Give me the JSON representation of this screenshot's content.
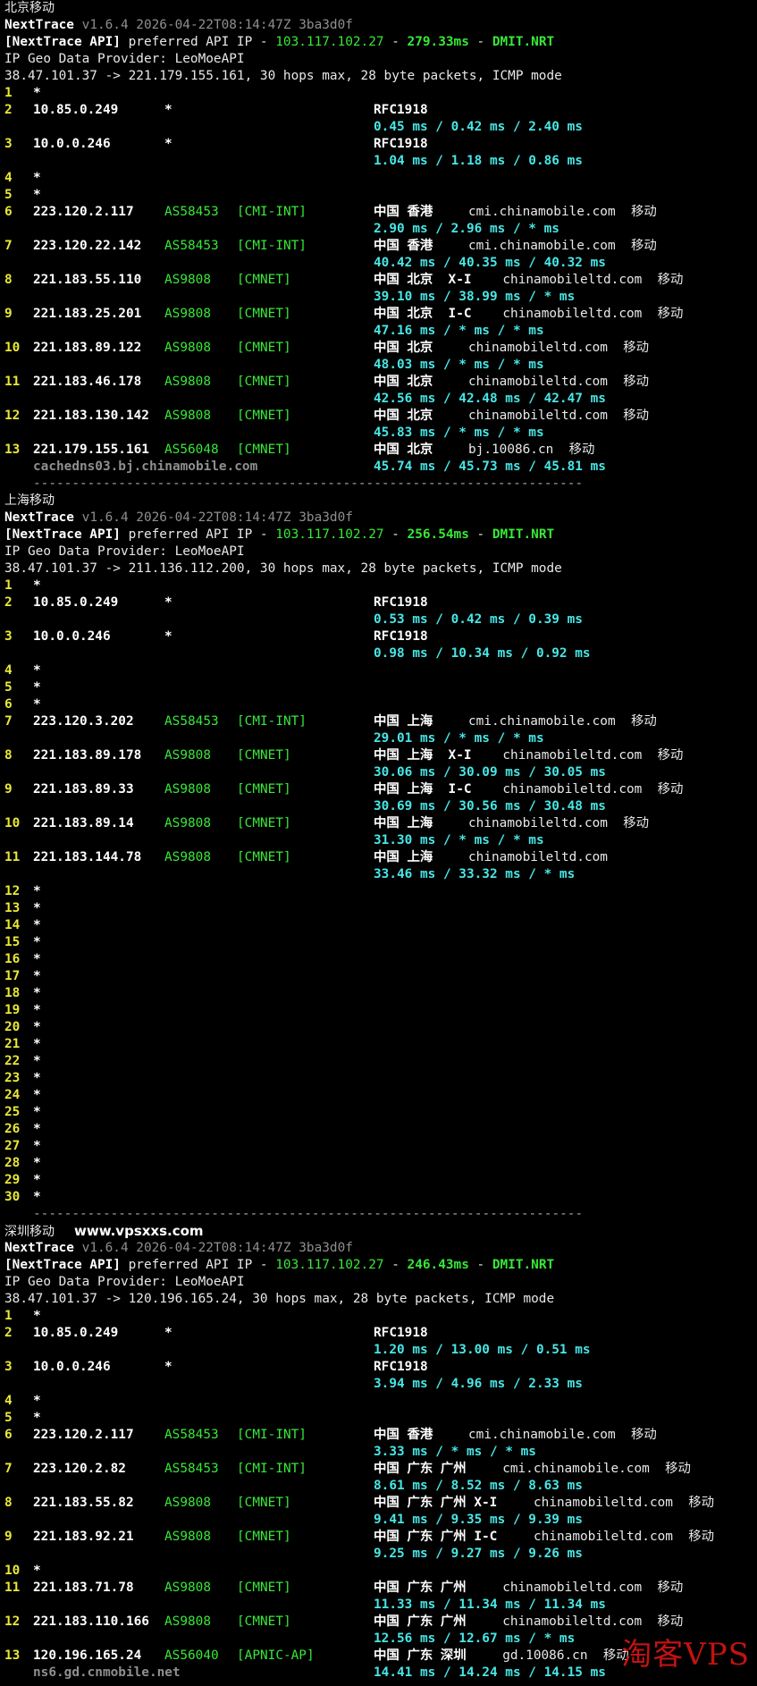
{
  "terminal": {
    "sections": [
      {
        "title": "北京移动",
        "site": "",
        "version": "v1.6.4 2026-04-22T08:14:47Z 3ba3d0f",
        "api_ip": "103.117.102.27",
        "api_latency": "279.33ms",
        "api_node": "DMIT.NRT",
        "geo_provider": "IP Geo Data Provider: LeoMoeAPI",
        "target_line": "38.47.101.37 -> 221.179.155.161, 30 hops max, 28 byte packets, ICMP mode",
        "rows": [
          {
            "hop": "1",
            "star": true
          },
          {
            "hop": "2",
            "ip": "10.85.0.249",
            "asn_star": "*",
            "geo": "RFC1918",
            "lat": "0.45 ms / 0.42 ms / 2.40 ms"
          },
          {
            "hop": "3",
            "ip": "10.0.0.246",
            "asn_star": "*",
            "geo": "RFC1918",
            "lat": "1.04 ms / 1.18 ms / 0.86 ms"
          },
          {
            "hop": "4",
            "star": true
          },
          {
            "hop": "5",
            "star": true
          },
          {
            "hop": "6",
            "ip": "223.120.2.117",
            "asn": "AS58453",
            "tag": "[CMI-INT]",
            "geo": "中国 香港",
            "host": "cmi.chinamobile.com  移动",
            "lat": "2.90 ms / 2.96 ms / * ms"
          },
          {
            "hop": "7",
            "ip": "223.120.22.142",
            "asn": "AS58453",
            "tag": "[CMI-INT]",
            "geo": "中国 香港",
            "host": "cmi.chinamobile.com  移动",
            "lat": "40.42 ms / 40.35 ms / 40.32 ms"
          },
          {
            "hop": "8",
            "ip": "221.183.55.110",
            "asn": "AS9808",
            "tag": "[CMNET]",
            "geo": "中国 北京  X-I",
            "host": "chinamobileltd.com  移动",
            "lat": "39.10 ms / 38.99 ms / * ms"
          },
          {
            "hop": "9",
            "ip": "221.183.25.201",
            "asn": "AS9808",
            "tag": "[CMNET]",
            "geo": "中国 北京  I-C",
            "host": "chinamobileltd.com  移动",
            "lat": "47.16 ms / * ms / * ms"
          },
          {
            "hop": "10",
            "ip": "221.183.89.122",
            "asn": "AS9808",
            "tag": "[CMNET]",
            "geo": "中国 北京",
            "host": "chinamobileltd.com  移动",
            "lat": "48.03 ms / * ms / * ms"
          },
          {
            "hop": "11",
            "ip": "221.183.46.178",
            "asn": "AS9808",
            "tag": "[CMNET]",
            "geo": "中国 北京",
            "host": "chinamobileltd.com  移动",
            "lat": "42.56 ms / 42.48 ms / 42.47 ms"
          },
          {
            "hop": "12",
            "ip": "221.183.130.142",
            "asn": "AS9808",
            "tag": "[CMNET]",
            "geo": "中国 北京",
            "host": "chinamobileltd.com  移动",
            "lat": "45.83 ms / * ms / * ms"
          },
          {
            "hop": "13",
            "ip": "221.179.155.161",
            "asn": "AS56048",
            "tag": "[CMNET]",
            "geo": "中国 北京",
            "host": "bj.10086.cn  移动",
            "lat": "45.74 ms / 45.73 ms / 45.81 ms",
            "ptr": "cachedns03.bj.chinamobile.com"
          }
        ]
      },
      {
        "title": "上海移动",
        "site": "",
        "version": "v1.6.4 2026-04-22T08:14:47Z 3ba3d0f",
        "api_ip": "103.117.102.27",
        "api_latency": "256.54ms",
        "api_node": "DMIT.NRT",
        "geo_provider": "IP Geo Data Provider: LeoMoeAPI",
        "target_line": "38.47.101.37 -> 211.136.112.200, 30 hops max, 28 byte packets, ICMP mode",
        "rows": [
          {
            "hop": "1",
            "star": true
          },
          {
            "hop": "2",
            "ip": "10.85.0.249",
            "asn_star": "*",
            "geo": "RFC1918",
            "lat": "0.53 ms / 0.42 ms / 0.39 ms"
          },
          {
            "hop": "3",
            "ip": "10.0.0.246",
            "asn_star": "*",
            "geo": "RFC1918",
            "lat": "0.98 ms / 10.34 ms / 0.92 ms"
          },
          {
            "hop": "4",
            "star": true
          },
          {
            "hop": "5",
            "star": true
          },
          {
            "hop": "6",
            "star": true
          },
          {
            "hop": "7",
            "ip": "223.120.3.202",
            "asn": "AS58453",
            "tag": "[CMI-INT]",
            "geo": "中国 上海",
            "host": "cmi.chinamobile.com  移动",
            "lat": "29.01 ms / * ms / * ms"
          },
          {
            "hop": "8",
            "ip": "221.183.89.178",
            "asn": "AS9808",
            "tag": "[CMNET]",
            "geo": "中国 上海  X-I",
            "host": "chinamobileltd.com  移动",
            "lat": "30.06 ms / 30.09 ms / 30.05 ms"
          },
          {
            "hop": "9",
            "ip": "221.183.89.33",
            "asn": "AS9808",
            "tag": "[CMNET]",
            "geo": "中国 上海  I-C",
            "host": "chinamobileltd.com  移动",
            "lat": "30.69 ms / 30.56 ms / 30.48 ms"
          },
          {
            "hop": "10",
            "ip": "221.183.89.14",
            "asn": "AS9808",
            "tag": "[CMNET]",
            "geo": "中国 上海",
            "host": "chinamobileltd.com  移动",
            "lat": "31.30 ms / * ms / * ms"
          },
          {
            "hop": "11",
            "ip": "221.183.144.78",
            "asn": "AS9808",
            "tag": "[CMNET]",
            "geo": "中国 上海",
            "host": "chinamobileltd.com",
            "lat": "33.46 ms / 33.32 ms / * ms"
          },
          {
            "hop": "12",
            "star": true
          },
          {
            "hop": "13",
            "star": true
          },
          {
            "hop": "14",
            "star": true
          },
          {
            "hop": "15",
            "star": true
          },
          {
            "hop": "16",
            "star": true
          },
          {
            "hop": "17",
            "star": true
          },
          {
            "hop": "18",
            "star": true
          },
          {
            "hop": "19",
            "star": true
          },
          {
            "hop": "20",
            "star": true
          },
          {
            "hop": "21",
            "star": true
          },
          {
            "hop": "22",
            "star": true
          },
          {
            "hop": "23",
            "star": true
          },
          {
            "hop": "24",
            "star": true
          },
          {
            "hop": "25",
            "star": true
          },
          {
            "hop": "26",
            "star": true
          },
          {
            "hop": "27",
            "star": true
          },
          {
            "hop": "28",
            "star": true
          },
          {
            "hop": "29",
            "star": true
          },
          {
            "hop": "30",
            "star": true
          }
        ]
      },
      {
        "title": "深圳移动",
        "site": "www.vpsxxs.com",
        "version": "v1.6.4 2026-04-22T08:14:47Z 3ba3d0f",
        "api_ip": "103.117.102.27",
        "api_latency": "246.43ms",
        "api_node": "DMIT.NRT",
        "geo_provider": "IP Geo Data Provider: LeoMoeAPI",
        "target_line": "38.47.101.37 -> 120.196.165.24, 30 hops max, 28 byte packets, ICMP mode",
        "rows": [
          {
            "hop": "1",
            "star": true
          },
          {
            "hop": "2",
            "ip": "10.85.0.249",
            "asn_star": "*",
            "geo": "RFC1918",
            "lat": "1.20 ms / 13.00 ms / 0.51 ms"
          },
          {
            "hop": "3",
            "ip": "10.0.0.246",
            "asn_star": "*",
            "geo": "RFC1918",
            "lat": "3.94 ms / 4.96 ms / 2.33 ms"
          },
          {
            "hop": "4",
            "star": true
          },
          {
            "hop": "5",
            "star": true
          },
          {
            "hop": "6",
            "ip": "223.120.2.117",
            "asn": "AS58453",
            "tag": "[CMI-INT]",
            "geo": "中国 香港",
            "host": "cmi.chinamobile.com  移动",
            "lat": "3.33 ms / * ms / * ms"
          },
          {
            "hop": "7",
            "ip": "223.120.2.82",
            "asn": "AS58453",
            "tag": "[CMI-INT]",
            "geo": "中国 广东 广州",
            "host": "cmi.chinamobile.com  移动",
            "lat": "8.61 ms / 8.52 ms / 8.63 ms"
          },
          {
            "hop": "8",
            "ip": "221.183.55.82",
            "asn": "AS9808",
            "tag": "[CMNET]",
            "geo": "中国 广东 广州 X-I",
            "host": "chinamobileltd.com  移动",
            "lat": "9.41 ms / 9.35 ms / 9.39 ms"
          },
          {
            "hop": "9",
            "ip": "221.183.92.21",
            "asn": "AS9808",
            "tag": "[CMNET]",
            "geo": "中国 广东 广州 I-C",
            "host": "chinamobileltd.com  移动",
            "lat": "9.25 ms / 9.27 ms / 9.26 ms"
          },
          {
            "hop": "10",
            "star": true
          },
          {
            "hop": "11",
            "ip": "221.183.71.78",
            "asn": "AS9808",
            "tag": "[CMNET]",
            "geo": "中国 广东 广州",
            "host": "chinamobileltd.com  移动",
            "lat": "11.33 ms / 11.34 ms / 11.34 ms"
          },
          {
            "hop": "12",
            "ip": "221.183.110.166",
            "asn": "AS9808",
            "tag": "[CMNET]",
            "geo": "中国 广东 广州",
            "host": "chinamobileltd.com  移动",
            "lat": "12.56 ms / 12.67 ms / * ms"
          },
          {
            "hop": "13",
            "ip": "120.196.165.24",
            "asn": "AS56040",
            "tag": "[APNIC-AP]",
            "geo": "中国 广东 深圳",
            "host": "gd.10086.cn  移动",
            "lat": "14.41 ms / 14.24 ms / 14.15 ms",
            "ptr": "ns6.gd.cnmobile.net"
          }
        ]
      }
    ],
    "labels": {
      "app": "NextTrace",
      "api_prefix": "[NextTrace API]",
      "api_mid": " preferred API IP - ",
      "dash": " - ",
      "star": "*",
      "separator": "-----------------------------------------------------------------------"
    },
    "watermark": "淘客VPS",
    "colors": {
      "background": "#000000",
      "hop_number": "#e8e838",
      "asn": "#38e838",
      "latency": "#48e6e6",
      "api_ip": "#38e838",
      "watermark": "#d41414"
    }
  }
}
